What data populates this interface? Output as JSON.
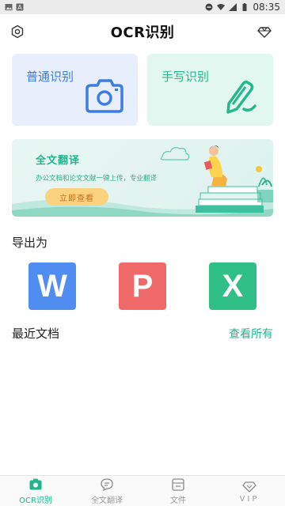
{
  "status_bar": {
    "time": "08:35"
  },
  "header": {
    "title": "OCR识别",
    "left_icon": "settings-hex-icon",
    "right_icon": "diamond-icon"
  },
  "cards": {
    "general": {
      "label": "普通识别",
      "icon": "camera-icon",
      "color": "#3b7de0"
    },
    "handwriting": {
      "label": "手写识别",
      "icon": "pen-icon",
      "color": "#25b88c"
    }
  },
  "banner": {
    "title": "全文翻译",
    "subtitle": "办公文档和论文文献一键上传，专业翻译",
    "button": "立即查看"
  },
  "export": {
    "title": "导出为",
    "options": [
      {
        "letter": "W",
        "color": "#4f8ef0"
      },
      {
        "letter": "P",
        "color": "#f06969"
      },
      {
        "letter": "X",
        "color": "#2fbf87"
      }
    ]
  },
  "recent": {
    "title": "最近文档",
    "see_all": "查看所有"
  },
  "bottom_nav": [
    {
      "label": "OCR识别",
      "icon": "camera-icon",
      "active": true
    },
    {
      "label": "全文翻译",
      "icon": "chat-icon",
      "active": false
    },
    {
      "label": "文件",
      "icon": "folder-icon",
      "active": false
    },
    {
      "label": "VIP",
      "icon": "diamond-icon",
      "active": false
    }
  ],
  "colors": {
    "accent": "#22b58d",
    "blue": "#3b7de0"
  }
}
